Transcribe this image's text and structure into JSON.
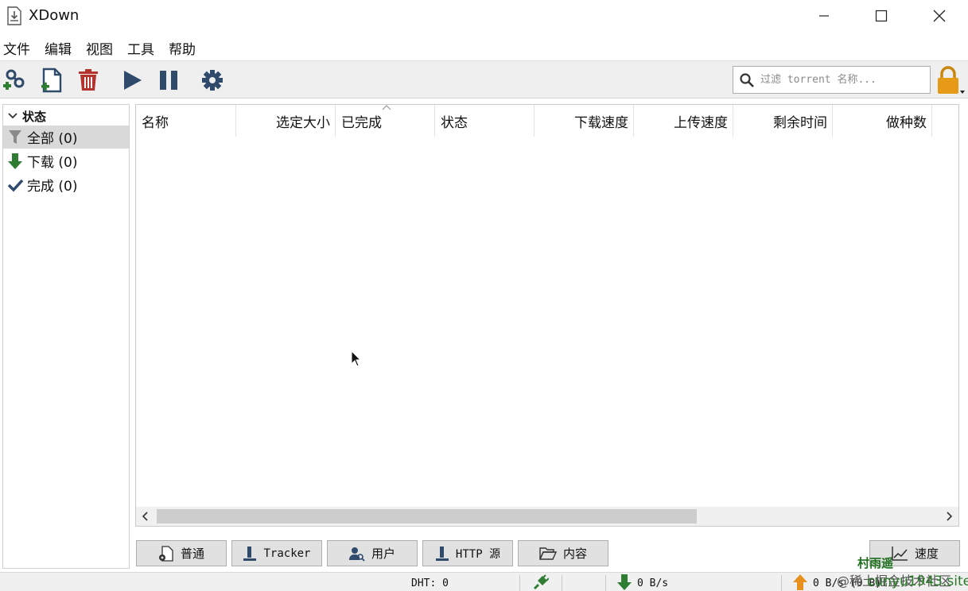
{
  "window": {
    "title": "XDown"
  },
  "menu": [
    "文件",
    "编辑",
    "视图",
    "工具",
    "帮助"
  ],
  "search": {
    "placeholder": "过滤 torrent 名称..."
  },
  "sidebar": {
    "header": "状态",
    "items": [
      {
        "label": "全部 (0)"
      },
      {
        "label": "下载 (0)"
      },
      {
        "label": "完成 (0)"
      }
    ]
  },
  "columns": [
    "名称",
    "选定大小",
    "已完成",
    "状态",
    "下载速度",
    "上传速度",
    "剩余时间",
    "做种数"
  ],
  "tabs": {
    "general": "普通",
    "tracker": "Tracker",
    "peers": "用户",
    "http": "HTTP 源",
    "content": "内容",
    "speed": "速度"
  },
  "status": {
    "dht": "DHT: 0",
    "download": "0 B/s",
    "upload": "0 B/s (0 B)"
  },
  "watermark": {
    "line1": "村雨遥",
    "line2": "@稀土掘金技术社区",
    "line3": "cunyu1943.site"
  },
  "colors": {
    "accent_blue": "#2f4a6b",
    "red": "#b5332c",
    "green": "#2e7d32",
    "orange": "#e8901e",
    "lock": "#e69a17"
  }
}
